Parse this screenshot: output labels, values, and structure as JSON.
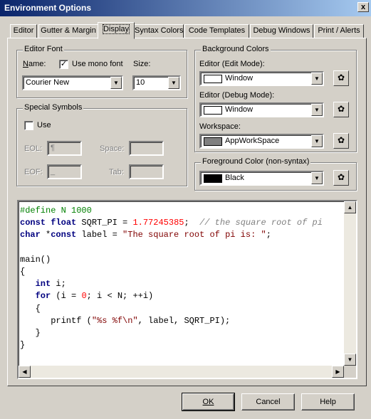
{
  "window": {
    "title": "Environment Options",
    "close_glyph": "x"
  },
  "tabs": [
    {
      "label": "Editor",
      "active": false
    },
    {
      "label": "Gutter & Margin",
      "active": false
    },
    {
      "label": "Display",
      "active": true
    },
    {
      "label": "Syntax Colors",
      "active": false
    },
    {
      "label": "Code Templates",
      "active": false
    },
    {
      "label": "Debug Windows",
      "active": false
    },
    {
      "label": "Print / Alerts",
      "active": false
    }
  ],
  "editor_font": {
    "group_label": "Editor Font",
    "name_label": "Name:",
    "mono_label": "Use mono font",
    "mono_checked": true,
    "size_label": "Size:",
    "font_value": "Courier New",
    "size_value": "10"
  },
  "special_symbols": {
    "group_label": "Special Symbols",
    "use_label": "Use",
    "use_checked": false,
    "eol_label": "EOL:",
    "eol_value": "¶",
    "eof_label": "EOF:",
    "eof_value": "_",
    "space_label": "Space:",
    "space_value": "",
    "tab_label": "Tab:",
    "tab_value": ""
  },
  "background_colors": {
    "group_label": "Background Colors",
    "edit_mode_label": "Editor (Edit Mode):",
    "edit_mode_value": "Window",
    "edit_mode_color": "#ffffff",
    "debug_mode_label": "Editor (Debug Mode):",
    "debug_mode_value": "Window",
    "debug_mode_color": "#ffffff",
    "workspace_label": "Workspace:",
    "workspace_value": "AppWorkSpace",
    "workspace_color": "#808080"
  },
  "foreground": {
    "group_label": "Foreground Color (non-syntax)",
    "value": "Black",
    "color": "#000000"
  },
  "preview_code": [
    [
      {
        "t": "#define N 1000",
        "c": "pp"
      }
    ],
    [
      {
        "t": "const",
        "c": "kw"
      },
      {
        "t": " "
      },
      {
        "t": "float",
        "c": "kw"
      },
      {
        "t": " SQRT_PI = "
      },
      {
        "t": "1.77245385",
        "c": "num"
      },
      {
        "t": ";  "
      },
      {
        "t": "// the square root of pi",
        "c": "cmt"
      }
    ],
    [
      {
        "t": "char",
        "c": "kw"
      },
      {
        "t": " *"
      },
      {
        "t": "const",
        "c": "kw"
      },
      {
        "t": " label = "
      },
      {
        "t": "\"The square root of pi is: \"",
        "c": "str"
      },
      {
        "t": ";"
      }
    ],
    [],
    [
      {
        "t": "main()"
      }
    ],
    [
      {
        "t": "{"
      }
    ],
    [
      {
        "t": "   "
      },
      {
        "t": "int",
        "c": "kw"
      },
      {
        "t": " i;"
      }
    ],
    [
      {
        "t": "   "
      },
      {
        "t": "for",
        "c": "kw"
      },
      {
        "t": " (i = "
      },
      {
        "t": "0",
        "c": "num"
      },
      {
        "t": "; i < N; ++i)"
      }
    ],
    [
      {
        "t": "   {"
      }
    ],
    [
      {
        "t": "      printf ("
      },
      {
        "t": "\"%s %f\\n\"",
        "c": "str"
      },
      {
        "t": ", label, SQRT_PI);"
      }
    ],
    [
      {
        "t": "   }"
      }
    ],
    [
      {
        "t": "}"
      }
    ]
  ],
  "buttons": {
    "ok": "OK",
    "cancel": "Cancel",
    "help": "Help"
  },
  "icons": {
    "dropdown": "▼",
    "scroll_up": "▲",
    "scroll_down": "▼",
    "scroll_left": "◀",
    "scroll_right": "▶",
    "check": "✓",
    "palette": "✿"
  }
}
